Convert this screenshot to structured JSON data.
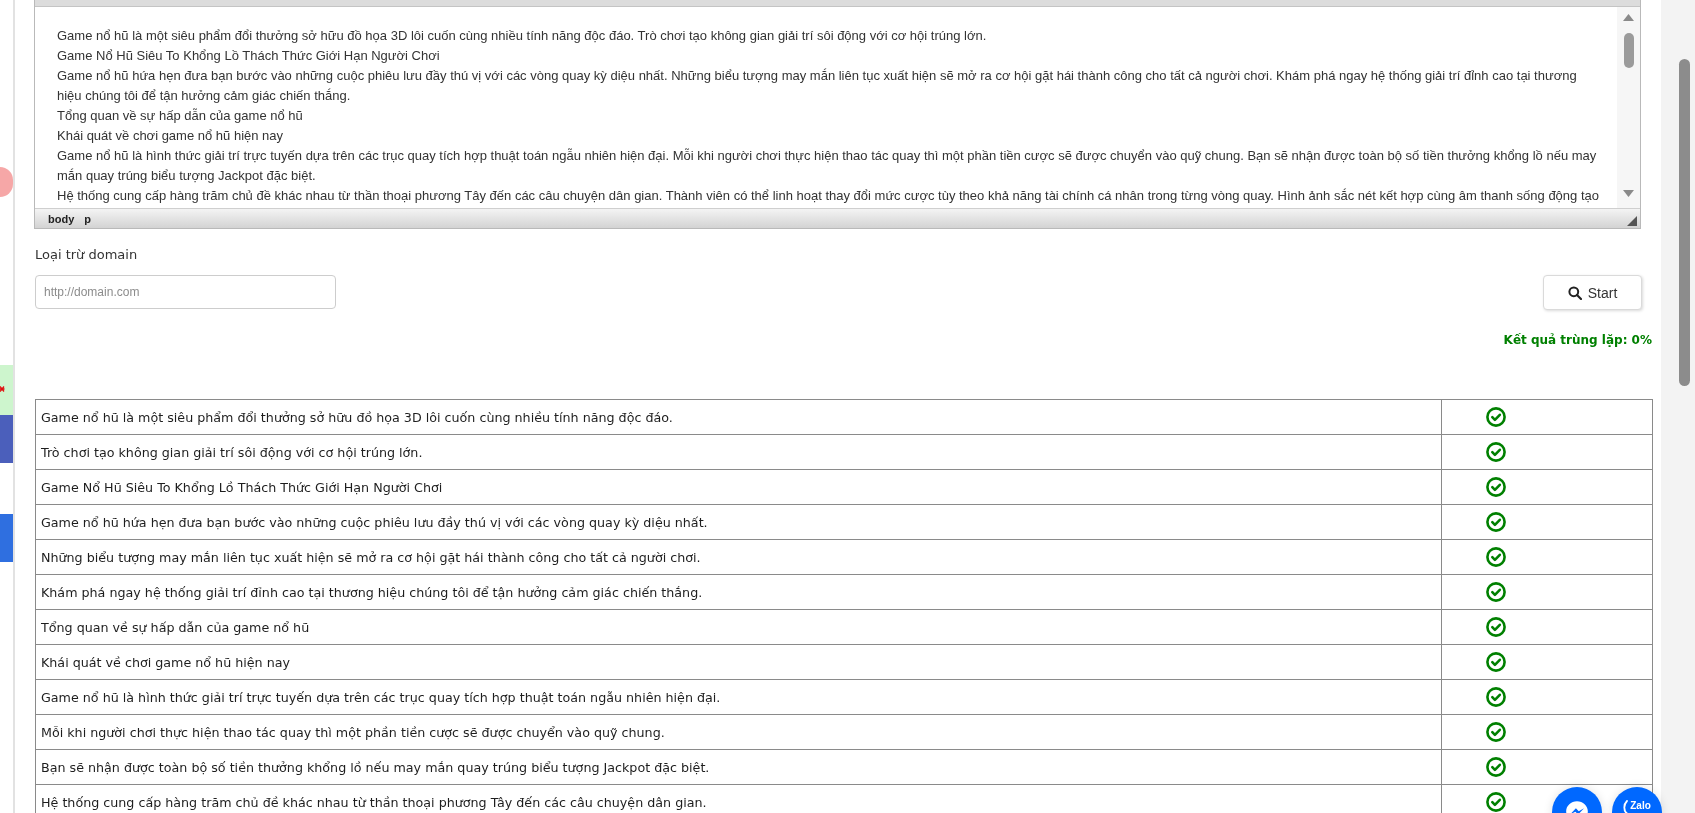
{
  "editor": {
    "paragraphs": [
      "Game nổ hũ là một siêu phẩm đổi thưởng sở hữu đồ họa 3D lôi cuốn cùng nhiều tính năng độc đáo. Trò chơi tạo không gian giải trí sôi động với cơ hội trúng lớn.",
      "Game Nổ Hũ Siêu To Khổng Lồ Thách Thức Giới Hạn Người Chơi",
      "Game nổ hũ hứa hẹn đưa bạn bước vào những cuộc phiêu lưu đầy thú vị với các vòng quay kỳ diệu nhất. Những biểu tượng may mắn liên tục xuất hiện sẽ mở ra cơ hội gặt hái thành công cho tất cả người chơi. Khám phá ngay hệ thống giải trí đỉnh cao tại thương hiệu chúng tôi để tận hưởng cảm giác chiến thắng.",
      "Tổng quan về sự hấp dẫn của game nổ hũ",
      "Khái quát về chơi game nổ hũ hiện nay",
      "Game nổ hũ là hình thức giải trí trực tuyến dựa trên các trục quay tích hợp thuật toán ngẫu nhiên hiện đại. Mỗi khi người chơi thực hiện thao tác quay thì một phần tiền cược sẽ được chuyển vào quỹ chung. Bạn sẽ nhận được toàn bộ số tiền thưởng khổng lồ nếu may mắn quay trúng biểu tượng Jackpot đặc biệt.",
      "Hệ thống cung cấp hàng trăm chủ đề khác nhau từ thần thoại phương Tây đến các câu chuyện dân gian. Thành viên có thể linh hoạt thay đổi mức cược tùy theo khả năng tài chính cá nhân trong từng vòng quay. Hình ảnh sắc nét kết hợp cùng âm thanh sống động tạo"
    ],
    "path": [
      "body",
      "p"
    ]
  },
  "exclude_domain": {
    "label": "Loại trừ domain",
    "placeholder": "http://domain.com"
  },
  "start_button": {
    "label": "Start"
  },
  "result": {
    "text": "Kết quả trùng lặp: 0%"
  },
  "results_table": {
    "rows": [
      {
        "sentence": "Game nổ hũ là một siêu phẩm đổi thưởng sở hữu đồ họa 3D lôi cuốn cùng nhiều tính năng độc đáo.",
        "duplicate": false
      },
      {
        "sentence": "Trò chơi tạo không gian giải trí sôi động với cơ hội trúng lớn.",
        "duplicate": false
      },
      {
        "sentence": "Game Nổ Hũ Siêu To Khổng Lồ Thách Thức Giới Hạn Người Chơi",
        "duplicate": false
      },
      {
        "sentence": "Game nổ hũ hứa hẹn đưa bạn bước vào những cuộc phiêu lưu đầy thú vị với các vòng quay kỳ diệu nhất.",
        "duplicate": false
      },
      {
        "sentence": "Những biểu tượng may mắn liên tục xuất hiện sẽ mở ra cơ hội gặt hái thành công cho tất cả người chơi.",
        "duplicate": false
      },
      {
        "sentence": "Khám phá ngay hệ thống giải trí đỉnh cao tại thương hiệu chúng tôi để tận hưởng cảm giác chiến thắng.",
        "duplicate": false
      },
      {
        "sentence": "Tổng quan về sự hấp dẫn của game nổ hũ",
        "duplicate": false
      },
      {
        "sentence": "Khái quát về chơi game nổ hũ hiện nay",
        "duplicate": false
      },
      {
        "sentence": "Game nổ hũ là hình thức giải trí trực tuyến dựa trên các trục quay tích hợp thuật toán ngẫu nhiên hiện đại.",
        "duplicate": false
      },
      {
        "sentence": "Mỗi khi người chơi thực hiện thao tác quay thì một phần tiền cược sẽ được chuyển vào quỹ chung.",
        "duplicate": false
      },
      {
        "sentence": "Bạn sẽ nhận được toàn bộ số tiền thưởng khổng lồ nếu may mắn quay trúng biểu tượng Jackpot đặc biệt.",
        "duplicate": false
      },
      {
        "sentence": "Hệ thống cung cấp hàng trăm chủ đề khác nhau từ thần thoại phương Tây đến các câu chuyện dân gian.",
        "duplicate": false
      }
    ]
  },
  "floating_buttons": [
    {
      "kind": "messenger"
    },
    {
      "kind": "zalo",
      "label": "Zalo"
    }
  ]
}
